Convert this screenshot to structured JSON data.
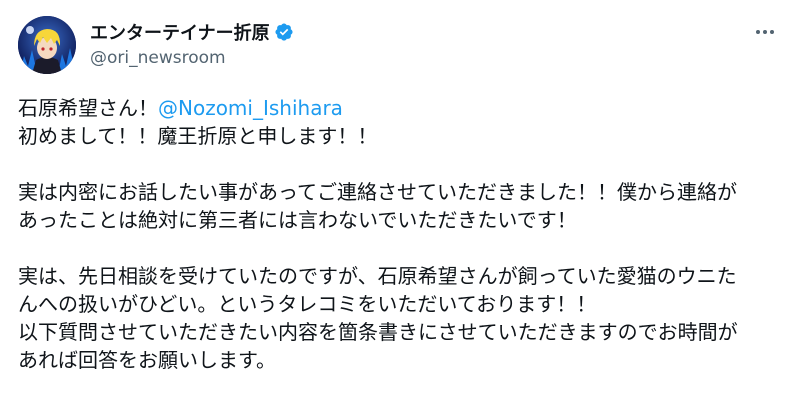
{
  "author": {
    "display_name": "エンターテイナー折原",
    "handle": "@ori_newsroom",
    "verified": true,
    "verified_color": "#1d9bf0",
    "avatar_icon": "anime-character-avatar"
  },
  "menu": {
    "icon": "more-horizontal-icon"
  },
  "tweet": {
    "line1_prefix": "石原希望さん！",
    "mention": "@Nozomi_Ishihara",
    "line2": "初めまして！！魔王折原と申します！！",
    "line3": "実は内密にお話したい事があってご連絡させていただきました！！僕から連絡が",
    "line4": "あったことは絶対に第三者には言わないでいただきたいです！",
    "line5": "実は、先日相談を受けていたのですが、石原希望さんが飼っていた愛猫のウニた",
    "line6": "んへの扱いがひどい。というタレコミをいただいております！！",
    "line7": "以下質問させていただきたい内容を箇条書きにさせていただきますのでお時間が",
    "line8": "あれば回答をお願いします。"
  },
  "colors": {
    "text": "#0f1419",
    "secondary": "#536471",
    "link": "#1d9bf0"
  }
}
